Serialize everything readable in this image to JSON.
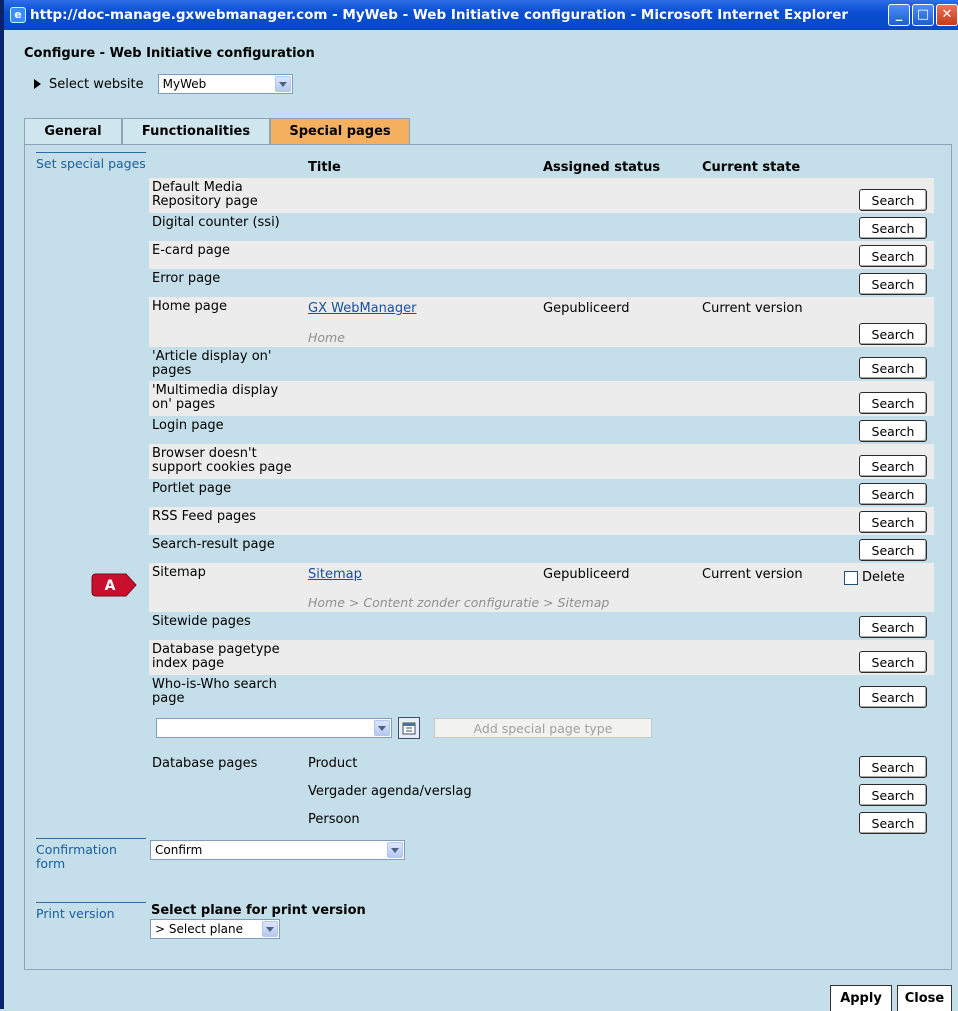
{
  "window": {
    "title": "http://doc-manage.gxwebmanager.com - MyWeb - Web Initiative configuration - Microsoft Internet Explorer",
    "minimize": "_",
    "maximize": "□",
    "close": "✕"
  },
  "page": {
    "title": "Configure - Web Initiative configuration",
    "select_website_label": "Select website",
    "website_value": "MyWeb"
  },
  "tabs": [
    {
      "label": "General"
    },
    {
      "label": "Functionalities"
    },
    {
      "label": "Special pages",
      "active": true
    }
  ],
  "special": {
    "section_label": "Set special pages",
    "headers": {
      "title": "Title",
      "status": "Assigned status",
      "state": "Current state"
    },
    "search_label": "Search",
    "delete_label": "Delete",
    "rows": [
      {
        "name": "Default Media Repository page"
      },
      {
        "name": "Digital counter (ssi)"
      },
      {
        "name": "E-card page"
      },
      {
        "name": "Error page"
      },
      {
        "name": "Home page",
        "title": "GX WebManager",
        "path": "Home",
        "status": "Gepubliceerd",
        "state": "Current version"
      },
      {
        "name": "'Article display on' pages"
      },
      {
        "name": "'Multimedia display on' pages"
      },
      {
        "name": "Login page"
      },
      {
        "name": "Browser doesn't support cookies page"
      },
      {
        "name": "Portlet page"
      },
      {
        "name": "RSS Feed pages"
      },
      {
        "name": "Search-result page"
      },
      {
        "name": "Sitemap",
        "title": "Sitemap",
        "path": "Home > Content zonder configuratie > Sitemap",
        "status": "Gepubliceerd",
        "state": "Current version"
      },
      {
        "name": "Sitewide pages"
      },
      {
        "name": "Database pagetype index page"
      },
      {
        "name": "Who-is-Who search page"
      }
    ],
    "marker_label": "A",
    "type_select_value": "",
    "add_button": "Add special page type",
    "database_label": "Database pages",
    "database_items": [
      "Product",
      "Vergader agenda/verslag",
      "Persoon"
    ]
  },
  "confirmation": {
    "section_label": "Confirmation form",
    "value": "Confirm"
  },
  "print": {
    "section_label": "Print version",
    "heading": "Select plane for print version",
    "value": "> Select plane"
  },
  "footer": {
    "apply": "Apply",
    "close": "Close"
  }
}
